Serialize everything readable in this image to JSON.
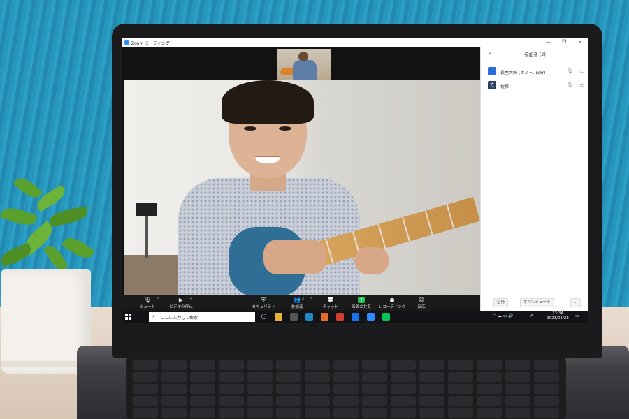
{
  "window": {
    "title": "Zoom ミーティング",
    "controls": [
      "—",
      "❐",
      "✕"
    ]
  },
  "toolbar": {
    "items": [
      {
        "label": "ミュート",
        "icon": "microphone-icon",
        "glyph": "🎙"
      },
      {
        "label": "ビデオの停止",
        "icon": "video-camera-icon",
        "glyph": "▶"
      },
      {
        "label": "セキュリティ",
        "icon": "shield-icon",
        "glyph": "⛨"
      },
      {
        "label": "参加者",
        "icon": "participants-icon",
        "glyph": "👥",
        "count": "2"
      },
      {
        "label": "チャット",
        "icon": "chat-icon",
        "glyph": "💬"
      },
      {
        "label": "画面の共有",
        "icon": "share-screen-icon",
        "glyph": "↑"
      },
      {
        "label": "レコーディング",
        "icon": "record-icon",
        "glyph": "●"
      },
      {
        "label": "反応",
        "icon": "reaction-icon",
        "glyph": "☺"
      }
    ]
  },
  "panel": {
    "header": "参加者 (2)",
    "participants": [
      {
        "name": "長屋大輔 (ホスト, 自分)",
        "avatar_color": "#2d6cdf",
        "avatar_text": ""
      },
      {
        "name": "佐藤",
        "avatar_color": "#2a3f5f",
        "avatar_text": "佐"
      }
    ],
    "invite_label": "招待",
    "mute_all_label": "すべてミュート",
    "more_label": "..."
  },
  "taskbar": {
    "search_placeholder": "ここに入力して検索",
    "apps": [
      {
        "icon": "task-view-icon",
        "color": "#111317",
        "glyph": "◯"
      },
      {
        "icon": "file-explorer-icon",
        "color": "#e8b23a",
        "glyph": ""
      },
      {
        "icon": "store-icon",
        "color": "#555",
        "glyph": ""
      },
      {
        "icon": "edge-icon",
        "color": "#1e88c9",
        "glyph": ""
      },
      {
        "icon": "slides-icon",
        "color": "#e46b2c",
        "glyph": ""
      },
      {
        "icon": "chrome-icon",
        "color": "#d23f31",
        "glyph": ""
      },
      {
        "icon": "messenger-icon",
        "color": "#1a73e8",
        "glyph": ""
      },
      {
        "icon": "zoom-icon",
        "color": "#2d8cff",
        "glyph": ""
      },
      {
        "icon": "line-icon",
        "color": "#06c755",
        "glyph": ""
      }
    ],
    "ime": "A",
    "time": "13:34",
    "date": "2021/01/23"
  }
}
